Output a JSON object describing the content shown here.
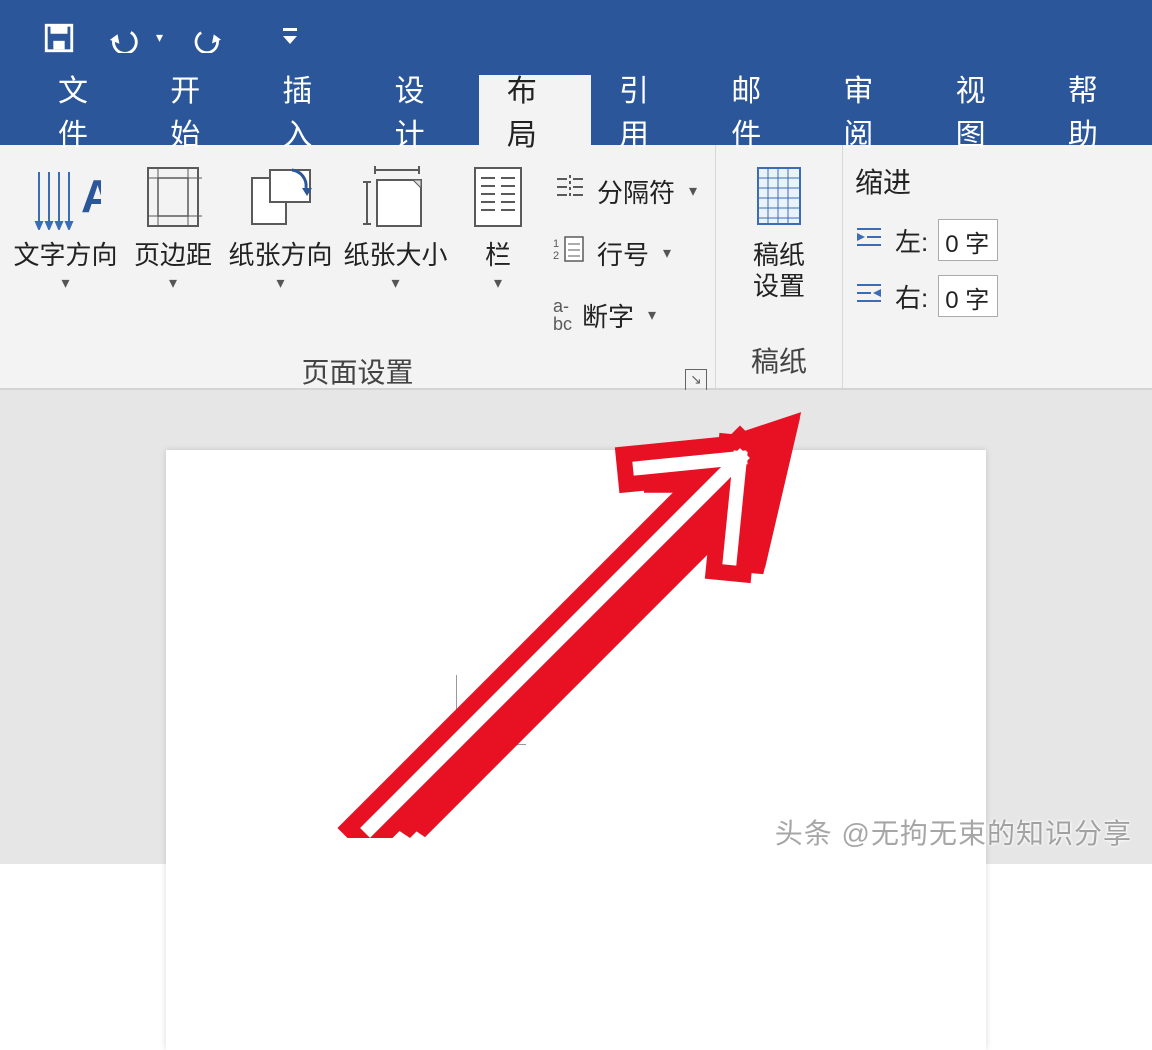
{
  "qat": {
    "save": "save",
    "undo": "undo",
    "redo": "redo",
    "more": "more"
  },
  "tabs": {
    "file": "文件",
    "home": "开始",
    "insert": "插入",
    "design": "设计",
    "layout": "布局",
    "ref": "引用",
    "mail": "邮件",
    "review": "审阅",
    "view": "视图",
    "help": "帮助"
  },
  "ribbon": {
    "page_setup": {
      "text_direction": "文字方向",
      "margins": "页边距",
      "orientation": "纸张方向",
      "size": "纸张大小",
      "columns": "栏",
      "breaks": "分隔符",
      "line_numbers": "行号",
      "hyphenation": "断字",
      "group_title": "页面设置"
    },
    "manuscript": {
      "settings_line1": "稿纸",
      "settings_line2": "设置",
      "group_title": "稿纸"
    },
    "indent": {
      "title": "缩进",
      "left_label": "左:",
      "right_label": "右:",
      "left_value": "0 字",
      "right_value": "0 字"
    }
  },
  "watermark": "头条 @无拘无束的知识分享"
}
